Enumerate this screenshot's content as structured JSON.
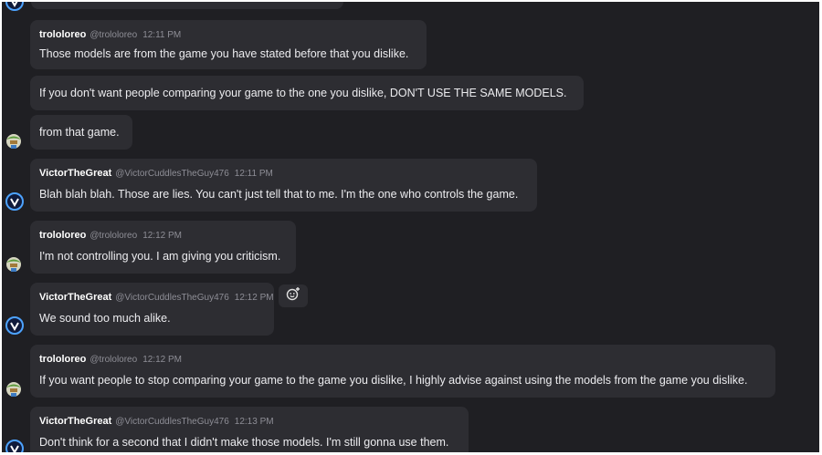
{
  "messages": [
    {
      "author": "trololoreo",
      "handle": "@trololoreo",
      "time": "12:11 PM",
      "text": "Those models are from the game you have stated before that you dislike."
    },
    {
      "text": "If you don't want people comparing your game to the one you dislike, DON'T USE THE SAME MODELS."
    },
    {
      "text": "from that game."
    },
    {
      "author": "VictorTheGreat",
      "handle": "@VictorCuddlesTheGuy476",
      "time": "12:11 PM",
      "text": "Blah blah blah. Those are lies. You can't just tell that to me. I'm the one who controls the game."
    },
    {
      "author": "trololoreo",
      "handle": "@trololoreo",
      "time": "12:12 PM",
      "text": "I'm not controlling you. I am giving you criticism."
    },
    {
      "author": "VictorTheGreat",
      "handle": "@VictorCuddlesTheGuy476",
      "time": "12:12 PM",
      "text": "We sound too much alike."
    },
    {
      "author": "trololoreo",
      "handle": "@trololoreo",
      "time": "12:12 PM",
      "text": "If you want people to stop comparing your game to the game you dislike, I highly advise against using the models from the game you dislike."
    },
    {
      "author": "VictorTheGreat",
      "handle": "@VictorCuddlesTheGuy476",
      "time": "12:13 PM",
      "text": "Don't think for a second that I didn't make those models. I'm still gonna use them."
    }
  ],
  "icons": {
    "add_reaction": "add-reaction-icon",
    "avatar_v": "victor-avatar",
    "avatar_t": "trololoreo-avatar"
  },
  "colors": {
    "background": "#1f1f23",
    "bubble": "#2d2d32",
    "accent_blue": "#4da3ff"
  }
}
